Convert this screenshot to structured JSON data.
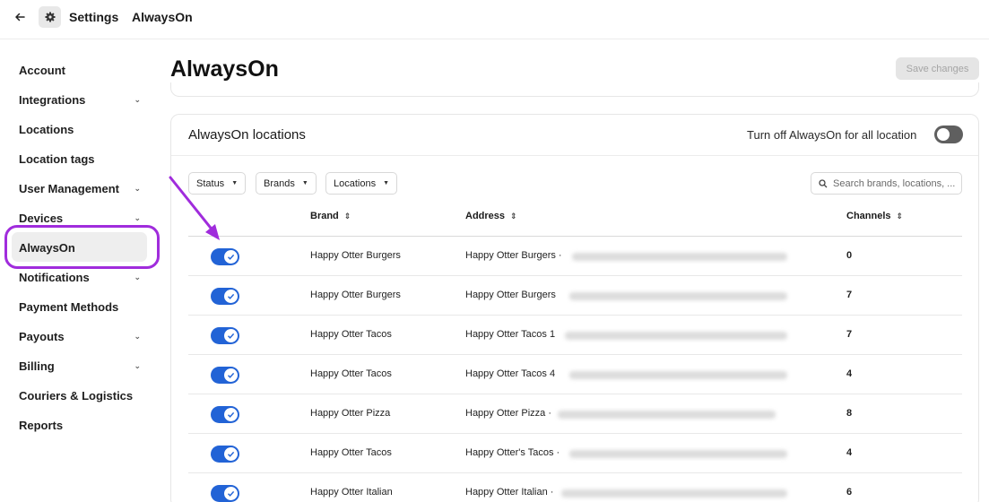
{
  "topbar": {
    "back_icon": "arrow-left-icon",
    "settings_icon": "gear-icon",
    "crumb_settings": "Settings",
    "crumb_current": "AlwaysOn"
  },
  "sidebar": {
    "items": [
      {
        "label": "Account",
        "chevron": false
      },
      {
        "label": "Integrations",
        "chevron": true
      },
      {
        "label": "Locations",
        "chevron": false
      },
      {
        "label": "Location tags",
        "chevron": false
      },
      {
        "label": "User Management",
        "chevron": true
      },
      {
        "label": "Devices",
        "chevron": true
      },
      {
        "label": "AlwaysOn",
        "chevron": false,
        "active": true
      },
      {
        "label": "Notifications",
        "chevron": true
      },
      {
        "label": "Payment Methods",
        "chevron": false
      },
      {
        "label": "Payouts",
        "chevron": true
      },
      {
        "label": "Billing",
        "chevron": true
      },
      {
        "label": "Couriers & Logistics",
        "chevron": false
      },
      {
        "label": "Reports",
        "chevron": false
      }
    ]
  },
  "main": {
    "title": "AlwaysOn",
    "save_label": "Save changes",
    "card": {
      "title": "AlwaysOn locations",
      "turn_off_label": "Turn off AlwaysOn for all location",
      "turn_off_enabled": false,
      "filters": {
        "status": "Status",
        "brands": "Brands",
        "locations": "Locations"
      },
      "search_placeholder": "Search brands, locations, ...",
      "columns": {
        "brand": "Brand",
        "address": "Address",
        "channels": "Channels"
      },
      "rows": [
        {
          "enabled": true,
          "brand": "Happy Otter Burgers",
          "address": "Happy Otter Burgers ·",
          "channels": "0"
        },
        {
          "enabled": true,
          "brand": "Happy Otter Burgers",
          "address": "Happy Otter Burgers",
          "channels": "7"
        },
        {
          "enabled": true,
          "brand": "Happy Otter Tacos",
          "address": "Happy Otter Tacos 1",
          "channels": "7"
        },
        {
          "enabled": true,
          "brand": "Happy Otter Tacos",
          "address": "Happy Otter Tacos 4",
          "channels": "4"
        },
        {
          "enabled": true,
          "brand": "Happy Otter Pizza",
          "address": "Happy Otter Pizza ·",
          "channels": "8"
        },
        {
          "enabled": true,
          "brand": "Happy Otter Tacos",
          "address": "Happy Otter's Tacos ·",
          "channels": "4"
        },
        {
          "enabled": true,
          "brand": "Happy Otter Italian",
          "address": "Happy Otter Italian ·",
          "channels": "6"
        }
      ]
    }
  },
  "colors": {
    "accent_toggle": "#2263d6",
    "annotation": "#a02cdc",
    "toggle_off": "#5f5f5f"
  }
}
